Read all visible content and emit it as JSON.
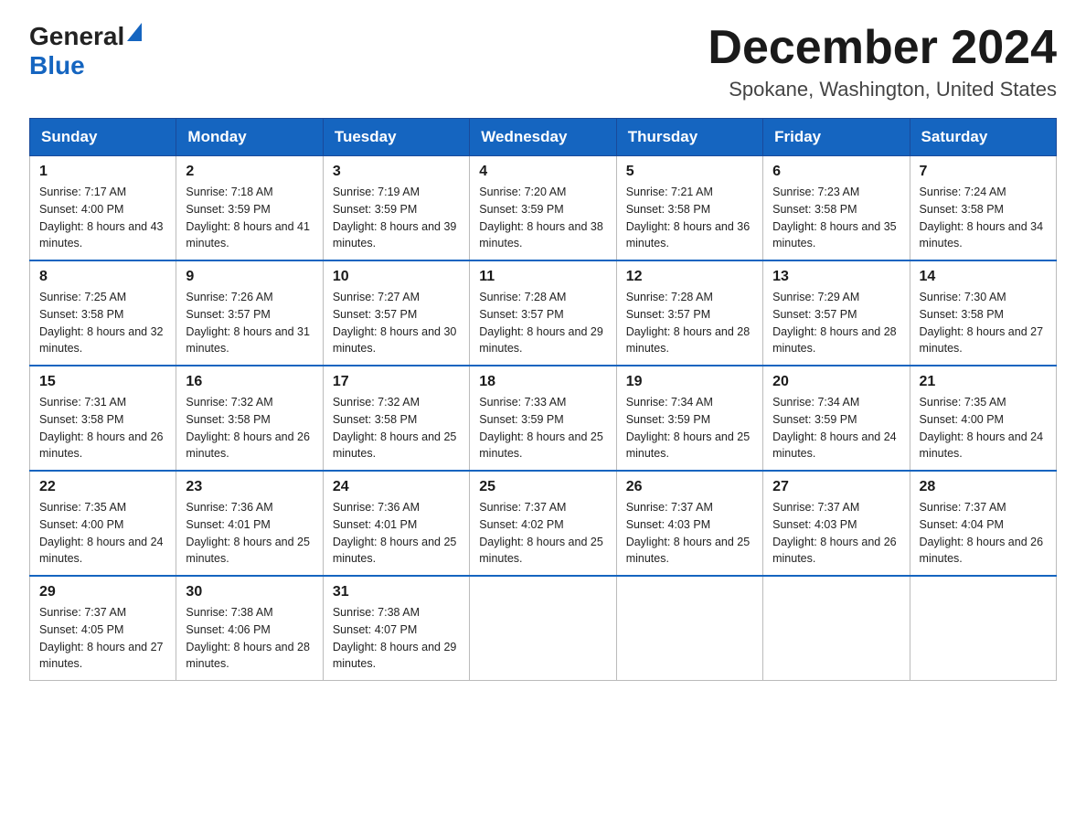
{
  "header": {
    "logo_general": "General",
    "logo_blue": "Blue",
    "month_title": "December 2024",
    "location": "Spokane, Washington, United States"
  },
  "days_of_week": [
    "Sunday",
    "Monday",
    "Tuesday",
    "Wednesday",
    "Thursday",
    "Friday",
    "Saturday"
  ],
  "weeks": [
    [
      {
        "day": "1",
        "sunrise": "7:17 AM",
        "sunset": "4:00 PM",
        "daylight": "8 hours and 43 minutes."
      },
      {
        "day": "2",
        "sunrise": "7:18 AM",
        "sunset": "3:59 PM",
        "daylight": "8 hours and 41 minutes."
      },
      {
        "day": "3",
        "sunrise": "7:19 AM",
        "sunset": "3:59 PM",
        "daylight": "8 hours and 39 minutes."
      },
      {
        "day": "4",
        "sunrise": "7:20 AM",
        "sunset": "3:59 PM",
        "daylight": "8 hours and 38 minutes."
      },
      {
        "day": "5",
        "sunrise": "7:21 AM",
        "sunset": "3:58 PM",
        "daylight": "8 hours and 36 minutes."
      },
      {
        "day": "6",
        "sunrise": "7:23 AM",
        "sunset": "3:58 PM",
        "daylight": "8 hours and 35 minutes."
      },
      {
        "day": "7",
        "sunrise": "7:24 AM",
        "sunset": "3:58 PM",
        "daylight": "8 hours and 34 minutes."
      }
    ],
    [
      {
        "day": "8",
        "sunrise": "7:25 AM",
        "sunset": "3:58 PM",
        "daylight": "8 hours and 32 minutes."
      },
      {
        "day": "9",
        "sunrise": "7:26 AM",
        "sunset": "3:57 PM",
        "daylight": "8 hours and 31 minutes."
      },
      {
        "day": "10",
        "sunrise": "7:27 AM",
        "sunset": "3:57 PM",
        "daylight": "8 hours and 30 minutes."
      },
      {
        "day": "11",
        "sunrise": "7:28 AM",
        "sunset": "3:57 PM",
        "daylight": "8 hours and 29 minutes."
      },
      {
        "day": "12",
        "sunrise": "7:28 AM",
        "sunset": "3:57 PM",
        "daylight": "8 hours and 28 minutes."
      },
      {
        "day": "13",
        "sunrise": "7:29 AM",
        "sunset": "3:57 PM",
        "daylight": "8 hours and 28 minutes."
      },
      {
        "day": "14",
        "sunrise": "7:30 AM",
        "sunset": "3:58 PM",
        "daylight": "8 hours and 27 minutes."
      }
    ],
    [
      {
        "day": "15",
        "sunrise": "7:31 AM",
        "sunset": "3:58 PM",
        "daylight": "8 hours and 26 minutes."
      },
      {
        "day": "16",
        "sunrise": "7:32 AM",
        "sunset": "3:58 PM",
        "daylight": "8 hours and 26 minutes."
      },
      {
        "day": "17",
        "sunrise": "7:32 AM",
        "sunset": "3:58 PM",
        "daylight": "8 hours and 25 minutes."
      },
      {
        "day": "18",
        "sunrise": "7:33 AM",
        "sunset": "3:59 PM",
        "daylight": "8 hours and 25 minutes."
      },
      {
        "day": "19",
        "sunrise": "7:34 AM",
        "sunset": "3:59 PM",
        "daylight": "8 hours and 25 minutes."
      },
      {
        "day": "20",
        "sunrise": "7:34 AM",
        "sunset": "3:59 PM",
        "daylight": "8 hours and 24 minutes."
      },
      {
        "day": "21",
        "sunrise": "7:35 AM",
        "sunset": "4:00 PM",
        "daylight": "8 hours and 24 minutes."
      }
    ],
    [
      {
        "day": "22",
        "sunrise": "7:35 AM",
        "sunset": "4:00 PM",
        "daylight": "8 hours and 24 minutes."
      },
      {
        "day": "23",
        "sunrise": "7:36 AM",
        "sunset": "4:01 PM",
        "daylight": "8 hours and 25 minutes."
      },
      {
        "day": "24",
        "sunrise": "7:36 AM",
        "sunset": "4:01 PM",
        "daylight": "8 hours and 25 minutes."
      },
      {
        "day": "25",
        "sunrise": "7:37 AM",
        "sunset": "4:02 PM",
        "daylight": "8 hours and 25 minutes."
      },
      {
        "day": "26",
        "sunrise": "7:37 AM",
        "sunset": "4:03 PM",
        "daylight": "8 hours and 25 minutes."
      },
      {
        "day": "27",
        "sunrise": "7:37 AM",
        "sunset": "4:03 PM",
        "daylight": "8 hours and 26 minutes."
      },
      {
        "day": "28",
        "sunrise": "7:37 AM",
        "sunset": "4:04 PM",
        "daylight": "8 hours and 26 minutes."
      }
    ],
    [
      {
        "day": "29",
        "sunrise": "7:37 AM",
        "sunset": "4:05 PM",
        "daylight": "8 hours and 27 minutes."
      },
      {
        "day": "30",
        "sunrise": "7:38 AM",
        "sunset": "4:06 PM",
        "daylight": "8 hours and 28 minutes."
      },
      {
        "day": "31",
        "sunrise": "7:38 AM",
        "sunset": "4:07 PM",
        "daylight": "8 hours and 29 minutes."
      },
      null,
      null,
      null,
      null
    ]
  ],
  "labels": {
    "sunrise": "Sunrise:",
    "sunset": "Sunset:",
    "daylight": "Daylight:"
  }
}
